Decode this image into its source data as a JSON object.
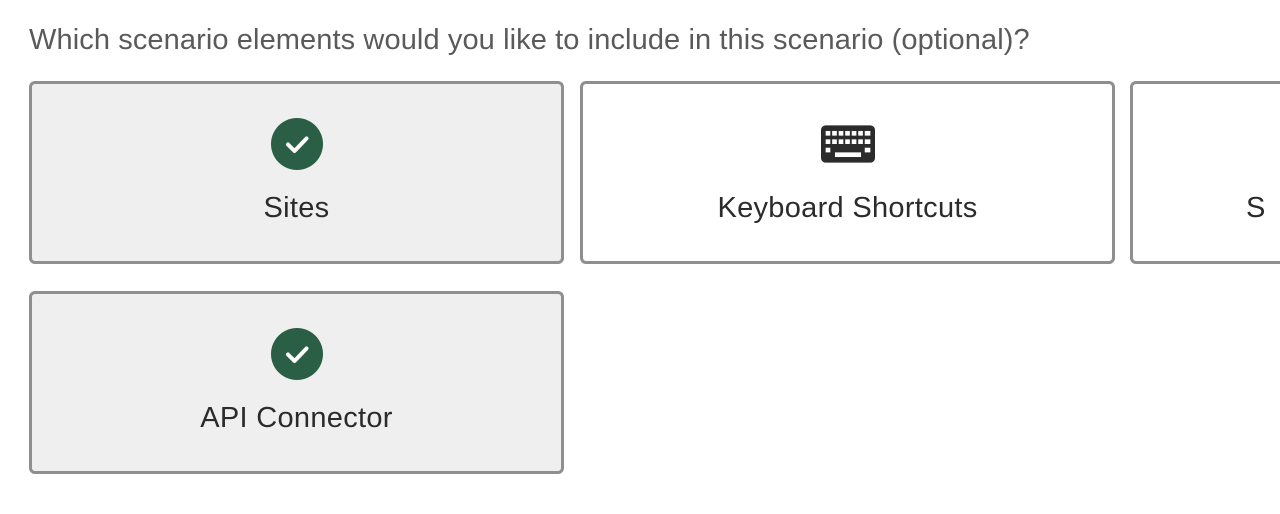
{
  "question": "Which scenario elements would you like to include in this scenario (optional)?",
  "colors": {
    "check_green": "#2a5e45",
    "selected_bg": "#efefef",
    "border": "#8f8f8f"
  },
  "options": [
    {
      "label": "Sites",
      "icon": "check-circle-icon",
      "selected": true
    },
    {
      "label": "Keyboard Shortcuts",
      "icon": "keyboard-icon",
      "selected": false
    },
    {
      "label": "S",
      "icon": "",
      "selected": false
    },
    {
      "label": "API Connector",
      "icon": "check-circle-icon",
      "selected": true
    }
  ]
}
